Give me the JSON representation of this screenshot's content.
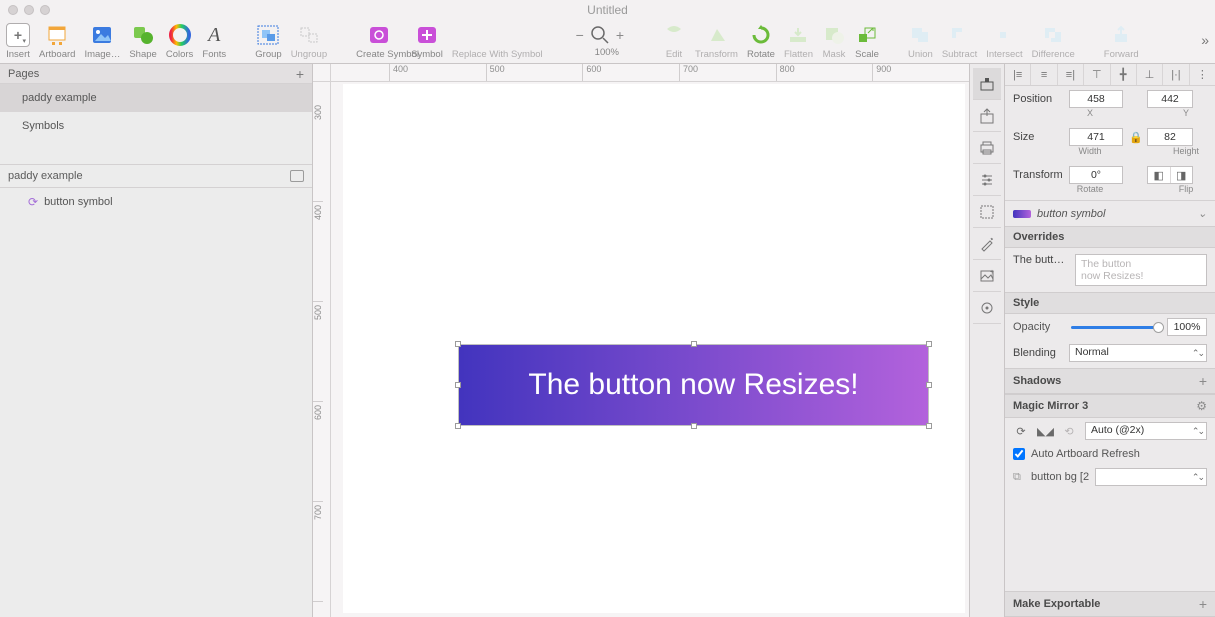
{
  "window": {
    "title": "Untitled"
  },
  "toolbar": {
    "insert": "Insert",
    "artboard": "Artboard",
    "image": "Image…",
    "shape": "Shape",
    "colors": "Colors",
    "fonts": "Fonts",
    "group": "Group",
    "ungroup": "Ungroup",
    "create_symbol": "Create Symbol",
    "symbol": "Symbol",
    "replace_symbol": "Replace With Symbol",
    "zoom_pct": "100%",
    "edit": "Edit",
    "transform": "Transform",
    "rotate": "Rotate",
    "flatten": "Flatten",
    "mask": "Mask",
    "scale": "Scale",
    "union": "Union",
    "subtract": "Subtract",
    "intersect": "Intersect",
    "difference": "Difference",
    "forward": "Forward"
  },
  "pages": {
    "header": "Pages",
    "items": [
      "paddy example",
      "Symbols"
    ],
    "selected": 0
  },
  "layers": {
    "artboard_name": "paddy example",
    "items": [
      "button symbol"
    ]
  },
  "rulers": {
    "top": [
      "400",
      "500",
      "600",
      "700",
      "800",
      "900"
    ],
    "left": [
      "300",
      "400",
      "500",
      "600",
      "700"
    ]
  },
  "canvas": {
    "button_text": "The button now Resizes!"
  },
  "inspector": {
    "position_label": "Position",
    "x": "458",
    "y": "442",
    "x_label": "X",
    "y_label": "Y",
    "size_label": "Size",
    "w": "471",
    "h": "82",
    "w_label": "Width",
    "h_label": "Height",
    "transform_label": "Transform",
    "rotate_val": "0°",
    "rotate_label": "Rotate",
    "flip_label": "Flip",
    "symbol_name": "button symbol",
    "overrides_head": "Overrides",
    "override_label": "The butto…",
    "override_placeholder": "The button\nnow Resizes!",
    "style_head": "Style",
    "opacity_label": "Opacity",
    "opacity_val": "100%",
    "blending_label": "Blending",
    "blending_val": "Normal",
    "shadows_head": "Shadows",
    "mm_head": "Magic Mirror 3",
    "mm_scale": "Auto (@2x)",
    "auto_refresh": "Auto Artboard Refresh",
    "bg_label": "button bg [2",
    "export_head": "Make Exportable"
  }
}
